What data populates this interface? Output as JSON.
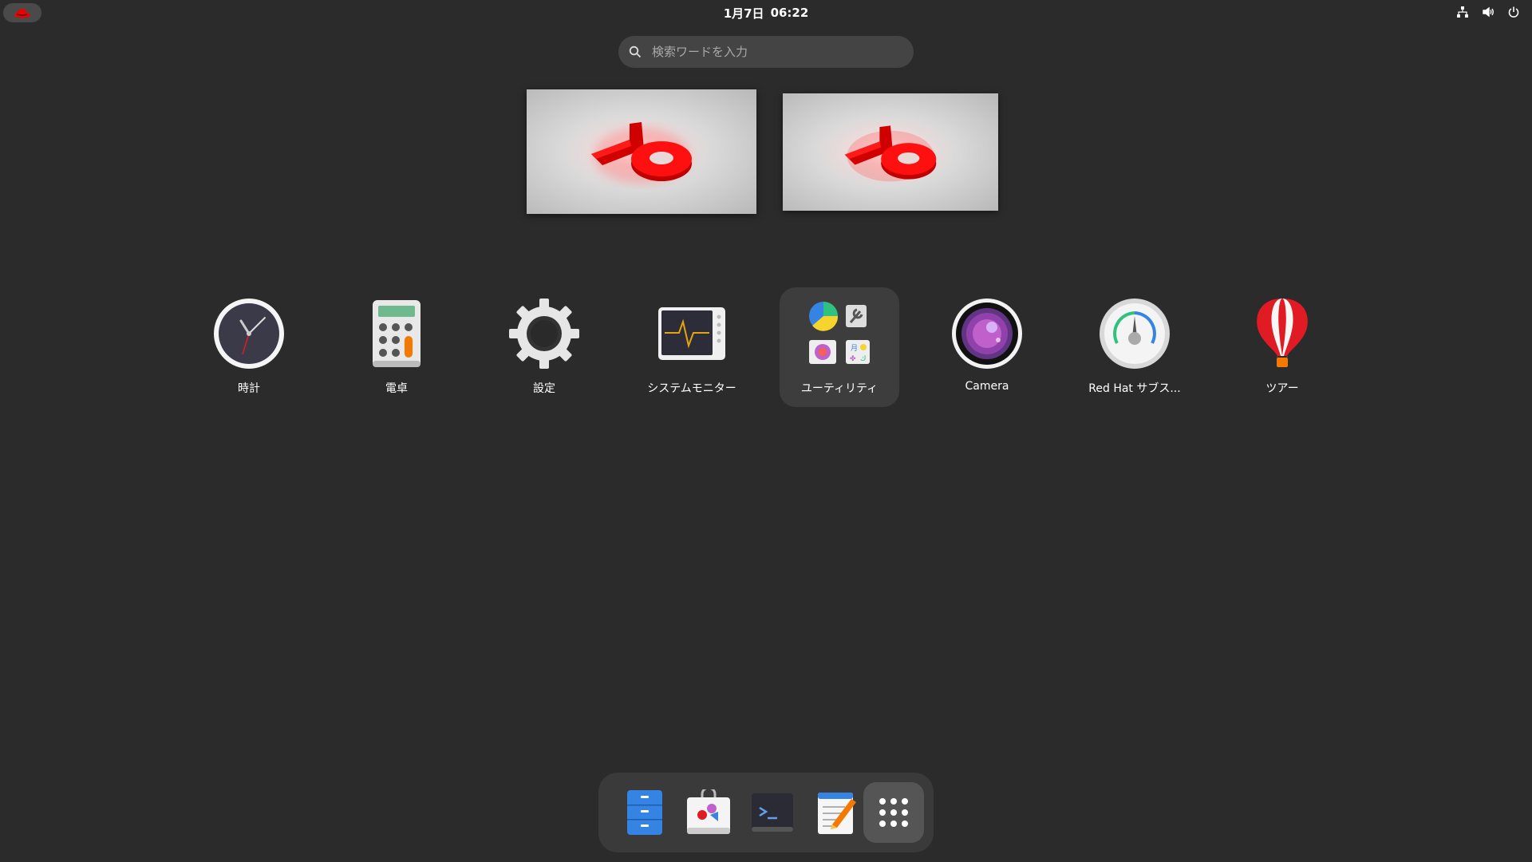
{
  "topbar": {
    "date": "1月7日",
    "time": "06:22"
  },
  "search": {
    "placeholder": "検索ワードを入力"
  },
  "apps": [
    {
      "label": "時計",
      "icon": "clock-icon"
    },
    {
      "label": "電卓",
      "icon": "calculator-icon"
    },
    {
      "label": "設定",
      "icon": "gear-icon"
    },
    {
      "label": "システムモニター",
      "icon": "system-monitor-icon"
    },
    {
      "label": "ユーティリティ",
      "icon": "utilities-folder-icon"
    },
    {
      "label": "Camera",
      "icon": "camera-icon"
    },
    {
      "label": "Red Hat サブス...",
      "icon": "subscription-gauge-icon"
    },
    {
      "label": "ツアー",
      "icon": "hot-air-balloon-icon"
    }
  ],
  "dock": [
    {
      "icon": "files-icon"
    },
    {
      "icon": "software-store-icon"
    },
    {
      "icon": "terminal-icon"
    },
    {
      "icon": "text-editor-icon"
    },
    {
      "icon": "show-apps-grid-icon"
    }
  ],
  "colors": {
    "background": "#2b2b2b",
    "accent_red": "#ee0000"
  }
}
